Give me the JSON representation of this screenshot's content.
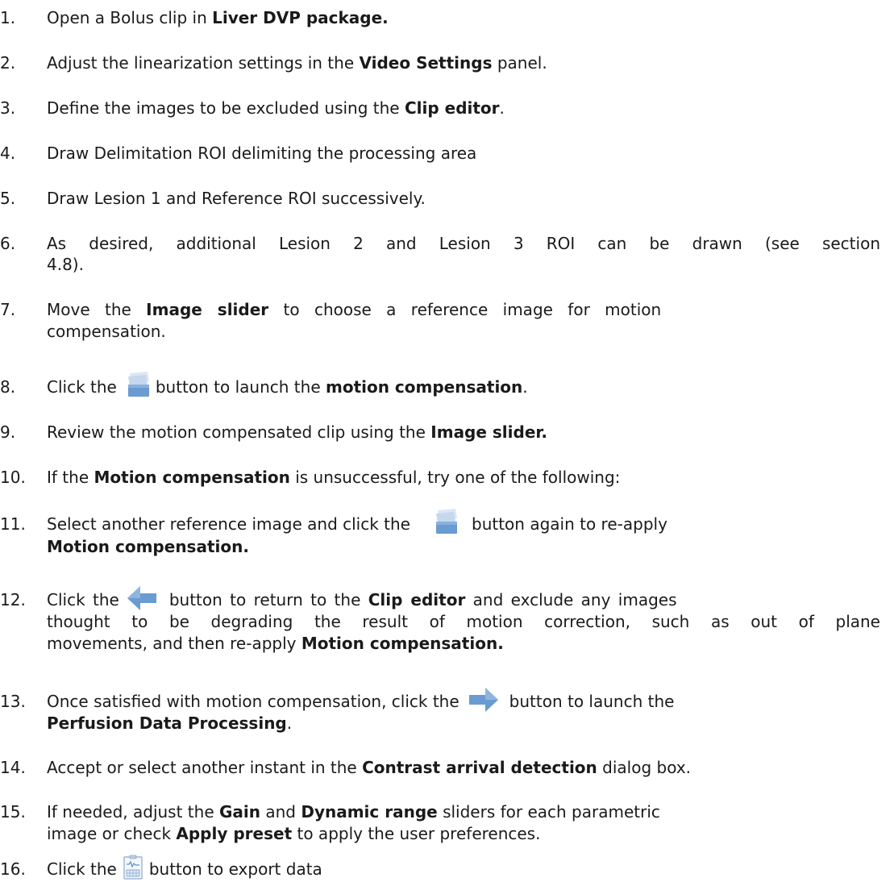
{
  "steps": [
    {
      "num": "1.",
      "text": "Open a Bolus clip in ",
      "bold": "Liver DVP package."
    },
    {
      "num": "2.",
      "text": "Adjust the linearization settings in the ",
      "bold": "Video Settings",
      "after": " panel."
    },
    {
      "num": "3.",
      "text": "Define the images to be excluded using the ",
      "bold": "Clip editor",
      "after": "."
    },
    {
      "num": "4.",
      "text": "Draw Delimitation ROI delimiting the processing area"
    },
    {
      "num": "5.",
      "text": "Draw Lesion 1 and Reference ROI successively."
    },
    {
      "num": "6.",
      "line1": "As desired, additional Lesion 2 and Lesion 3 ROI can be drawn (see section",
      "line2": "4.8)."
    },
    {
      "num": "7.",
      "a": "Move the ",
      "bold": "Image slider",
      "b": " to choose a reference image for motion",
      "line2": "compensation."
    },
    {
      "num": "8.",
      "a": "Click the",
      "b": "button to launch the ",
      "bold": "motion compensation",
      "after": "."
    },
    {
      "num": "9.",
      "text": "Review the motion compensated clip using the ",
      "bold": "Image slider."
    },
    {
      "num": "10.",
      "a": "If the ",
      "bold": "Motion compensation",
      "b": " is unsuccessful, try one of the following:"
    },
    {
      "num": "11.",
      "a": "Select another reference image and click the",
      "b": "button again to re-apply",
      "bold2": "Motion compensation."
    },
    {
      "num": "12.",
      "a": "Click the",
      "b": "button to return to the ",
      "bold": "Clip editor",
      "c": " and exclude any images",
      "line2": "thought to be degrading the result of motion correction, such as out of plane",
      "line3a": "movements, and then re-apply ",
      "bold3": "Motion compensation."
    },
    {
      "num": "13.",
      "a": "Once satisfied with motion compensation, click the",
      "b": "button to launch the",
      "bold2": "Perfusion Data Processing",
      "after2": "."
    },
    {
      "num": "14.",
      "a": "Accept or select another instant in the ",
      "bold": "Contrast arrival detection",
      "b": " dialog box."
    },
    {
      "num": "15.",
      "a": "If needed, adjust the ",
      "bold": "Gain",
      "b": " and ",
      "bold1b": "Dynamic range",
      "c": " sliders for each parametric",
      "line2a": "image or check ",
      "bold2": "Apply preset",
      "line2b": " to apply the user preferences."
    },
    {
      "num": "16.",
      "a": "Click the",
      "b": "button to export data"
    }
  ],
  "icons": {
    "motion": "motion-compensation-icon",
    "back": "back-arrow-icon",
    "forward": "forward-arrow-icon",
    "export": "export-data-icon"
  },
  "colors": {
    "icon_blue": "#5b8fc9",
    "icon_light": "#c9daee"
  }
}
